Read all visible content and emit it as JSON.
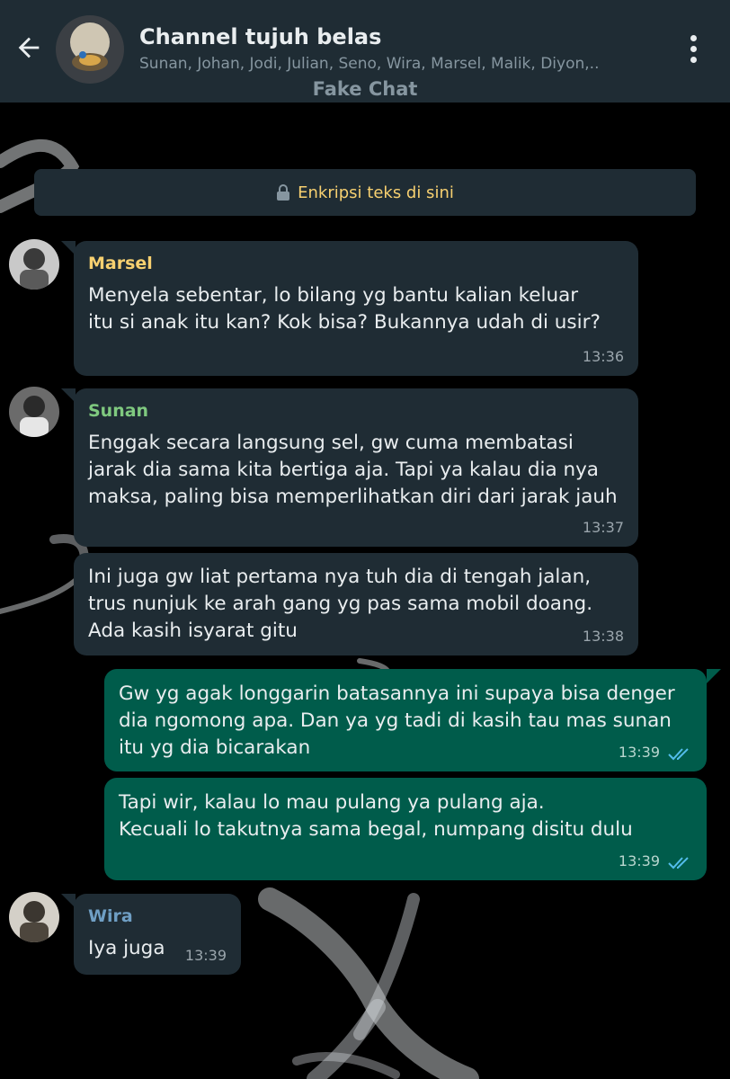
{
  "header": {
    "title": "Channel tujuh belas",
    "members": "Sunan, Johan, Jodi, Julian, Seno, Wira, Marsel, Malik, Diyon,..",
    "subtitle": "Fake Chat",
    "back_icon": "arrow-left-icon",
    "menu_icon": "more-vertical-icon"
  },
  "encryption": {
    "label": "Enkripsi teks di sini",
    "icon": "lock-icon"
  },
  "colors": {
    "header_bg": "#1f2c34",
    "incoming_bubble": "#1f2c34",
    "outgoing_bubble": "#005c4b",
    "marsel_name": "#f7d070",
    "sunan_name": "#7fc97f",
    "wira_name": "#6f9fc4",
    "read_ticks": "#53bdeb"
  },
  "messages": [
    {
      "direction": "in",
      "sender": "Marsel",
      "text": "Menyela sebentar, lo bilang yg bantu kalian keluar\nitu si anak itu kan? Kok bisa? Bukannya udah di usir?",
      "time": "13:36"
    },
    {
      "direction": "in",
      "sender": "Sunan",
      "text": "Enggak secara langsung sel, gw cuma membatasi\njarak dia sama kita bertiga aja. Tapi ya kalau dia nya\nmaksa, paling bisa memperlihatkan diri dari jarak jauh",
      "time": "13:37"
    },
    {
      "direction": "in",
      "sender": "",
      "text": "Ini juga gw liat pertama nya tuh dia di tengah jalan,\ntrus nunjuk ke arah gang yg pas sama mobil doang.\nAda kasih isyarat gitu",
      "time": "13:38"
    },
    {
      "direction": "out",
      "text": "Gw yg agak longgarin batasannya ini supaya bisa denger\ndia ngomong apa. Dan ya yg tadi di kasih tau mas sunan\nitu yg dia bicarakan",
      "time": "13:39",
      "status_icon": "double-check-icon"
    },
    {
      "direction": "out",
      "text": "Tapi wir, kalau lo mau pulang ya pulang aja.\nKecuali lo takutnya sama begal, numpang disitu dulu",
      "time": "13:39",
      "status_icon": "double-check-icon"
    },
    {
      "direction": "in",
      "sender": "Wira",
      "text": "Iya juga",
      "time": "13:39"
    }
  ]
}
